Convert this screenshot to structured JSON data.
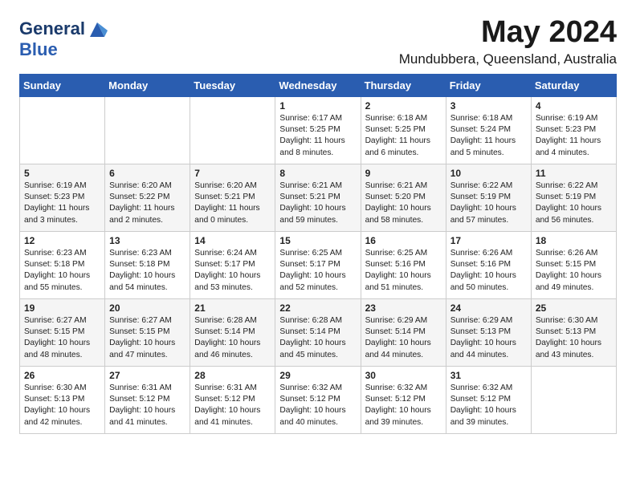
{
  "logo": {
    "line1": "General",
    "line2": "Blue"
  },
  "title": "May 2024",
  "subtitle": "Mundubbera, Queensland, Australia",
  "days_of_week": [
    "Sunday",
    "Monday",
    "Tuesday",
    "Wednesday",
    "Thursday",
    "Friday",
    "Saturday"
  ],
  "weeks": [
    [
      {
        "day": "",
        "info": ""
      },
      {
        "day": "",
        "info": ""
      },
      {
        "day": "",
        "info": ""
      },
      {
        "day": "1",
        "info": "Sunrise: 6:17 AM\nSunset: 5:25 PM\nDaylight: 11 hours\nand 8 minutes."
      },
      {
        "day": "2",
        "info": "Sunrise: 6:18 AM\nSunset: 5:25 PM\nDaylight: 11 hours\nand 6 minutes."
      },
      {
        "day": "3",
        "info": "Sunrise: 6:18 AM\nSunset: 5:24 PM\nDaylight: 11 hours\nand 5 minutes."
      },
      {
        "day": "4",
        "info": "Sunrise: 6:19 AM\nSunset: 5:23 PM\nDaylight: 11 hours\nand 4 minutes."
      }
    ],
    [
      {
        "day": "5",
        "info": "Sunrise: 6:19 AM\nSunset: 5:23 PM\nDaylight: 11 hours\nand 3 minutes."
      },
      {
        "day": "6",
        "info": "Sunrise: 6:20 AM\nSunset: 5:22 PM\nDaylight: 11 hours\nand 2 minutes."
      },
      {
        "day": "7",
        "info": "Sunrise: 6:20 AM\nSunset: 5:21 PM\nDaylight: 11 hours\nand 0 minutes."
      },
      {
        "day": "8",
        "info": "Sunrise: 6:21 AM\nSunset: 5:21 PM\nDaylight: 10 hours\nand 59 minutes."
      },
      {
        "day": "9",
        "info": "Sunrise: 6:21 AM\nSunset: 5:20 PM\nDaylight: 10 hours\nand 58 minutes."
      },
      {
        "day": "10",
        "info": "Sunrise: 6:22 AM\nSunset: 5:19 PM\nDaylight: 10 hours\nand 57 minutes."
      },
      {
        "day": "11",
        "info": "Sunrise: 6:22 AM\nSunset: 5:19 PM\nDaylight: 10 hours\nand 56 minutes."
      }
    ],
    [
      {
        "day": "12",
        "info": "Sunrise: 6:23 AM\nSunset: 5:18 PM\nDaylight: 10 hours\nand 55 minutes."
      },
      {
        "day": "13",
        "info": "Sunrise: 6:23 AM\nSunset: 5:18 PM\nDaylight: 10 hours\nand 54 minutes."
      },
      {
        "day": "14",
        "info": "Sunrise: 6:24 AM\nSunset: 5:17 PM\nDaylight: 10 hours\nand 53 minutes."
      },
      {
        "day": "15",
        "info": "Sunrise: 6:25 AM\nSunset: 5:17 PM\nDaylight: 10 hours\nand 52 minutes."
      },
      {
        "day": "16",
        "info": "Sunrise: 6:25 AM\nSunset: 5:16 PM\nDaylight: 10 hours\nand 51 minutes."
      },
      {
        "day": "17",
        "info": "Sunrise: 6:26 AM\nSunset: 5:16 PM\nDaylight: 10 hours\nand 50 minutes."
      },
      {
        "day": "18",
        "info": "Sunrise: 6:26 AM\nSunset: 5:15 PM\nDaylight: 10 hours\nand 49 minutes."
      }
    ],
    [
      {
        "day": "19",
        "info": "Sunrise: 6:27 AM\nSunset: 5:15 PM\nDaylight: 10 hours\nand 48 minutes."
      },
      {
        "day": "20",
        "info": "Sunrise: 6:27 AM\nSunset: 5:15 PM\nDaylight: 10 hours\nand 47 minutes."
      },
      {
        "day": "21",
        "info": "Sunrise: 6:28 AM\nSunset: 5:14 PM\nDaylight: 10 hours\nand 46 minutes."
      },
      {
        "day": "22",
        "info": "Sunrise: 6:28 AM\nSunset: 5:14 PM\nDaylight: 10 hours\nand 45 minutes."
      },
      {
        "day": "23",
        "info": "Sunrise: 6:29 AM\nSunset: 5:14 PM\nDaylight: 10 hours\nand 44 minutes."
      },
      {
        "day": "24",
        "info": "Sunrise: 6:29 AM\nSunset: 5:13 PM\nDaylight: 10 hours\nand 44 minutes."
      },
      {
        "day": "25",
        "info": "Sunrise: 6:30 AM\nSunset: 5:13 PM\nDaylight: 10 hours\nand 43 minutes."
      }
    ],
    [
      {
        "day": "26",
        "info": "Sunrise: 6:30 AM\nSunset: 5:13 PM\nDaylight: 10 hours\nand 42 minutes."
      },
      {
        "day": "27",
        "info": "Sunrise: 6:31 AM\nSunset: 5:12 PM\nDaylight: 10 hours\nand 41 minutes."
      },
      {
        "day": "28",
        "info": "Sunrise: 6:31 AM\nSunset: 5:12 PM\nDaylight: 10 hours\nand 41 minutes."
      },
      {
        "day": "29",
        "info": "Sunrise: 6:32 AM\nSunset: 5:12 PM\nDaylight: 10 hours\nand 40 minutes."
      },
      {
        "day": "30",
        "info": "Sunrise: 6:32 AM\nSunset: 5:12 PM\nDaylight: 10 hours\nand 39 minutes."
      },
      {
        "day": "31",
        "info": "Sunrise: 6:32 AM\nSunset: 5:12 PM\nDaylight: 10 hours\nand 39 minutes."
      },
      {
        "day": "",
        "info": ""
      }
    ]
  ]
}
